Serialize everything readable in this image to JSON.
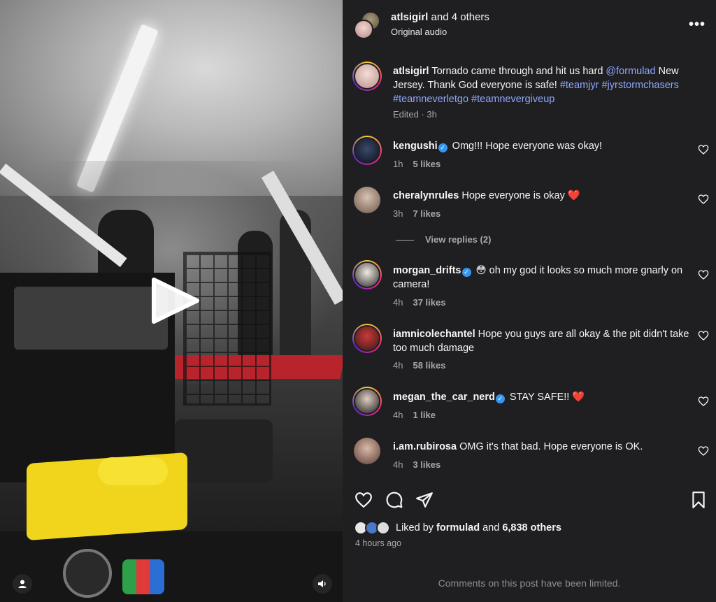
{
  "header": {
    "username": "atlsigirl",
    "and_others": " and 4 others",
    "audio": "Original audio"
  },
  "caption": {
    "username": "atlsigirl",
    "text_part1": " Tornado came through and hit us hard ",
    "mention": "@formulad",
    "text_part2": " New Jersey. Thank God everyone is safe! ",
    "hashtag1": "#teamjyr",
    "hashtag2": "#jyrstormchasers",
    "hashtag3": "#teamneverletgo",
    "hashtag4": "#teamnevergiveup",
    "meta": "Edited · 3h"
  },
  "comments": [
    {
      "username": "kengushi",
      "verified": true,
      "text": " Omg!!! Hope everyone was okay!",
      "time": "1h",
      "likes": "5 likes"
    },
    {
      "username": "cheralynrules",
      "verified": false,
      "text": " Hope everyone is okay ❤️",
      "time": "3h",
      "likes": "7 likes"
    },
    {
      "username": "morgan_drifts",
      "verified": true,
      "text": " 😳 oh my god it looks so much more gnarly on camera!",
      "time": "4h",
      "likes": "37 likes"
    },
    {
      "username": "iamnicolechantel",
      "verified": false,
      "text": " Hope you guys are all okay & the pit didn't take too much damage",
      "time": "4h",
      "likes": "58 likes"
    },
    {
      "username": "megan_the_car_nerd",
      "verified": true,
      "text": " STAY SAFE!! ❤️",
      "time": "4h",
      "likes": "1 like"
    },
    {
      "username": "i.am.rubirosa",
      "verified": false,
      "text": " OMG it's that bad. Hope everyone is OK.",
      "time": "4h",
      "likes": "3 likes"
    }
  ],
  "view_replies": "View replies (2)",
  "likes_summary": {
    "prefix": "Liked by ",
    "user": "formulad",
    "middle": " and ",
    "count": "6,838 others"
  },
  "posted_time": "4 hours ago",
  "comments_limited": "Comments on this post have been limited.",
  "icons": {
    "more": "more-options-icon",
    "like": "heart-icon",
    "comment": "comment-icon",
    "share": "share-icon",
    "save": "bookmark-icon",
    "play": "play-icon",
    "audio": "speaker-icon",
    "tags": "user-tag-icon"
  },
  "colors": {
    "background": "#1f1f21",
    "link": "#8fa8ff",
    "verified": "#3797f0",
    "muted": "#a8a8a8"
  }
}
